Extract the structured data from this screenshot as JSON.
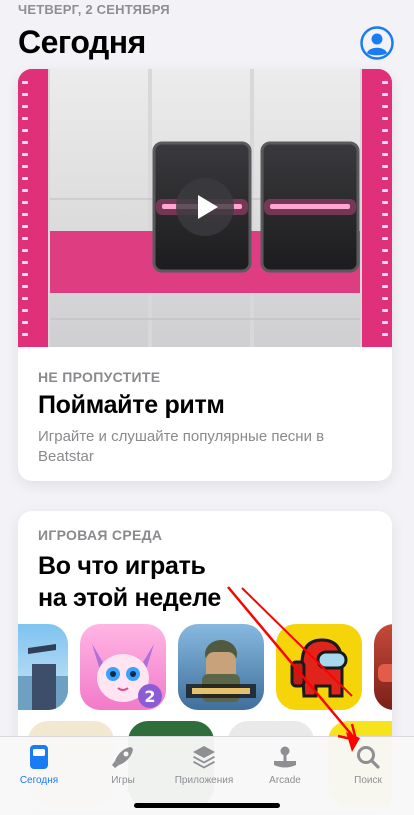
{
  "header": {
    "date": "ЧЕТВЕРГ, 2 СЕНТЯБРЯ",
    "title": "Сегодня"
  },
  "cards": [
    {
      "eyebrow": "НЕ ПРОПУСТИТЕ",
      "title": "Поймайте ритм",
      "description": "Играйте и слушайте популярные песни в Beatstar"
    },
    {
      "eyebrow": "ИГРОВАЯ СРЕДА",
      "title_line1": "Во что играть",
      "title_line2": "на этой неделе",
      "apps": [
        "app-icon",
        "talking-angela-icon",
        "pubg-battlegrounds-icon",
        "among-us-icon",
        "racing-app-icon"
      ]
    }
  ],
  "tabbar": {
    "tabs": [
      {
        "label": "Сегодня",
        "icon": "today-icon",
        "active": true
      },
      {
        "label": "Игры",
        "icon": "rocket-icon",
        "active": false
      },
      {
        "label": "Приложения",
        "icon": "layers-icon",
        "active": false
      },
      {
        "label": "Arcade",
        "icon": "arcade-joystick-icon",
        "active": false
      },
      {
        "label": "Поиск",
        "icon": "search-icon",
        "active": false
      }
    ]
  },
  "colors": {
    "accent": "#1a7cf3",
    "inactive": "#8e8e93",
    "hero_pink": "#e0307a",
    "annotation_arrow": "#ff0000"
  }
}
